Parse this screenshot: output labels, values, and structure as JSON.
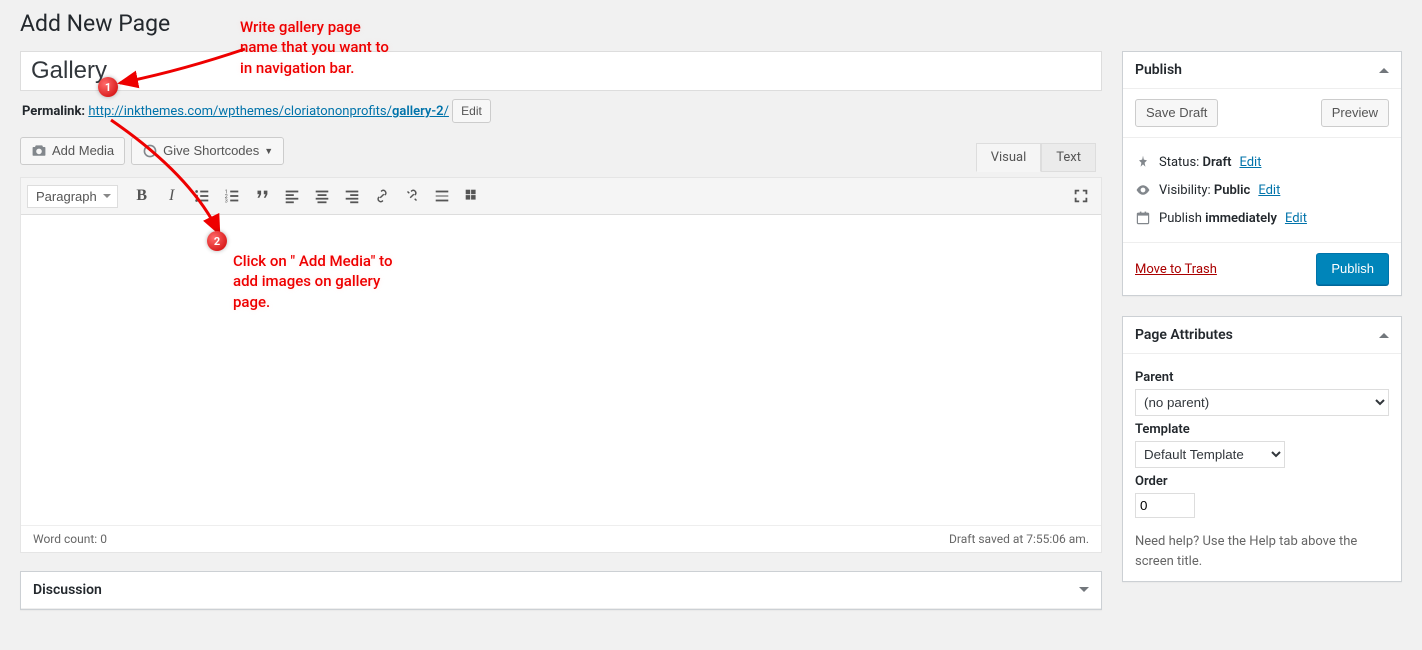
{
  "page": {
    "heading": "Add New Page",
    "title_value": "Gallery",
    "permalink_label": "Permalink:",
    "permalink_base": "http://inkthemes.com/wpthemes/cloriatononprofits/",
    "permalink_slug": "gallery-2",
    "permalink_edit": "Edit"
  },
  "media": {
    "add_media": "Add Media",
    "give_shortcodes": "Give Shortcodes"
  },
  "editor": {
    "tab_visual": "Visual",
    "tab_text": "Text",
    "format_select": "Paragraph",
    "word_count_label": "Word count: ",
    "word_count_value": "0",
    "draft_saved": "Draft saved at 7:55:06 am."
  },
  "publish": {
    "title": "Publish",
    "save_draft": "Save Draft",
    "preview": "Preview",
    "status_label": "Status: ",
    "status_value": "Draft",
    "visibility_label": "Visibility: ",
    "visibility_value": "Public",
    "publish_label": "Publish ",
    "publish_value": "immediately",
    "edit": "Edit",
    "trash": "Move to Trash",
    "publish_btn": "Publish"
  },
  "attributes": {
    "title": "Page Attributes",
    "parent_label": "Parent",
    "parent_value": "(no parent)",
    "template_label": "Template",
    "template_value": "Default Template",
    "order_label": "Order",
    "order_value": "0",
    "help": "Need help? Use the Help tab above the screen title."
  },
  "discussion": {
    "title": "Discussion"
  },
  "annotations": {
    "a1_text": "Write gallery page\nname that you want to\nin navigation bar.",
    "a1_num": "1",
    "a2_text": "Click on \" Add Media\" to\nadd images on gallery\npage.",
    "a2_num": "2"
  }
}
